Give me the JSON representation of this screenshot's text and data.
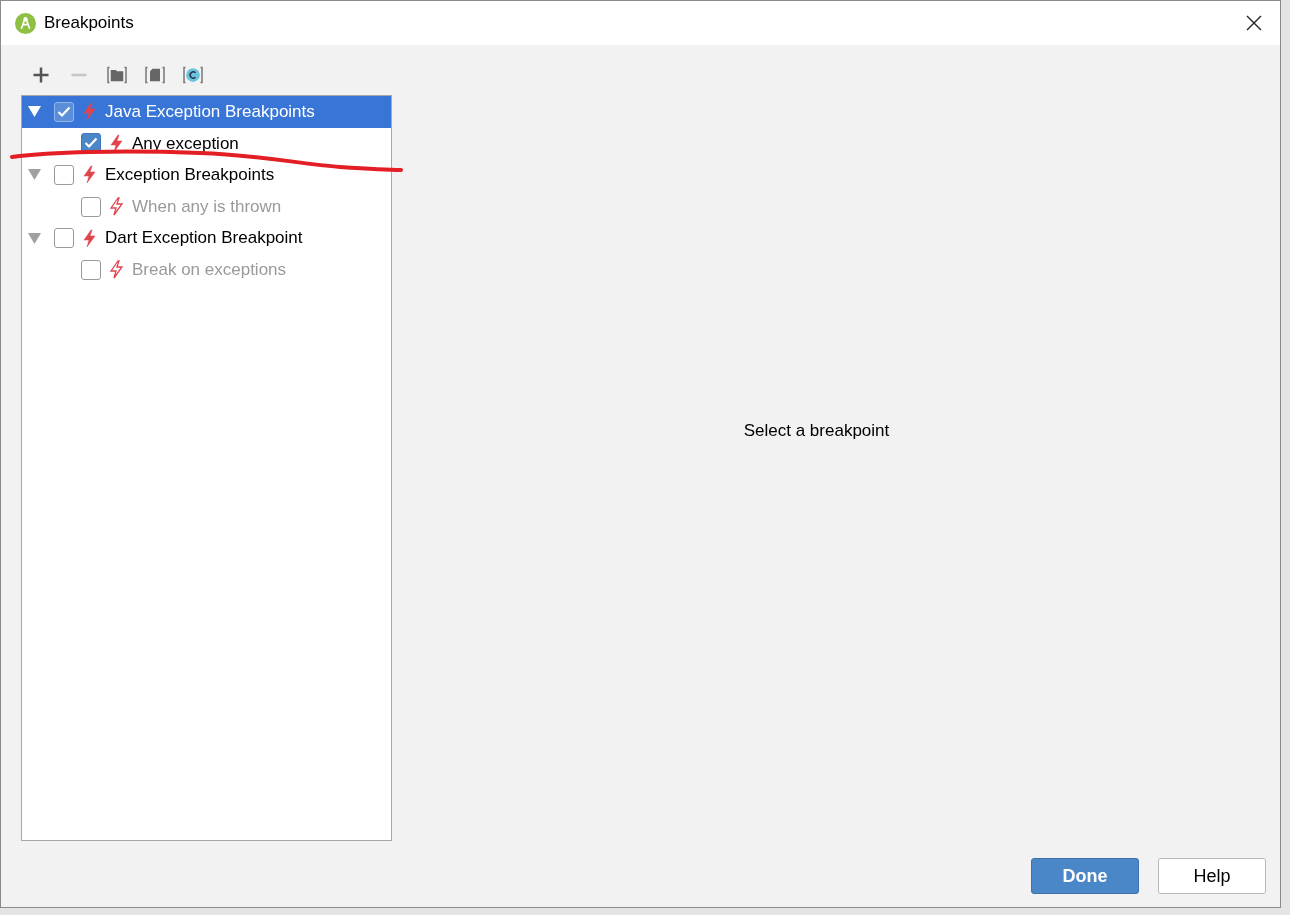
{
  "window": {
    "title": "Breakpoints"
  },
  "toolbar": [
    {
      "kind": "add",
      "disabled": false
    },
    {
      "kind": "remove",
      "disabled": true
    },
    {
      "kind": "folder",
      "disabled": false
    },
    {
      "kind": "file",
      "disabled": false
    },
    {
      "kind": "class",
      "disabled": false
    }
  ],
  "tree": [
    {
      "label": "Java Exception Breakpoints",
      "selected": true,
      "checked": true,
      "expanded": true,
      "disabled": false,
      "children": [
        {
          "label": "Any exception",
          "selected": false,
          "checked": true,
          "disabled": false
        }
      ]
    },
    {
      "label": "Exception Breakpoints",
      "selected": false,
      "checked": false,
      "expanded": true,
      "disabled": false,
      "children": [
        {
          "label": "When any is thrown",
          "selected": false,
          "checked": false,
          "disabled": true
        }
      ]
    },
    {
      "label": "Dart Exception Breakpoint",
      "selected": false,
      "checked": false,
      "expanded": true,
      "disabled": false,
      "children": [
        {
          "label": "Break on exceptions",
          "selected": false,
          "checked": false,
          "disabled": true
        }
      ]
    }
  ],
  "detail": {
    "message": "Select a breakpoint"
  },
  "buttons": [
    {
      "label": "Done",
      "kind": "primary"
    },
    {
      "label": "Help",
      "kind": "secondary"
    }
  ]
}
